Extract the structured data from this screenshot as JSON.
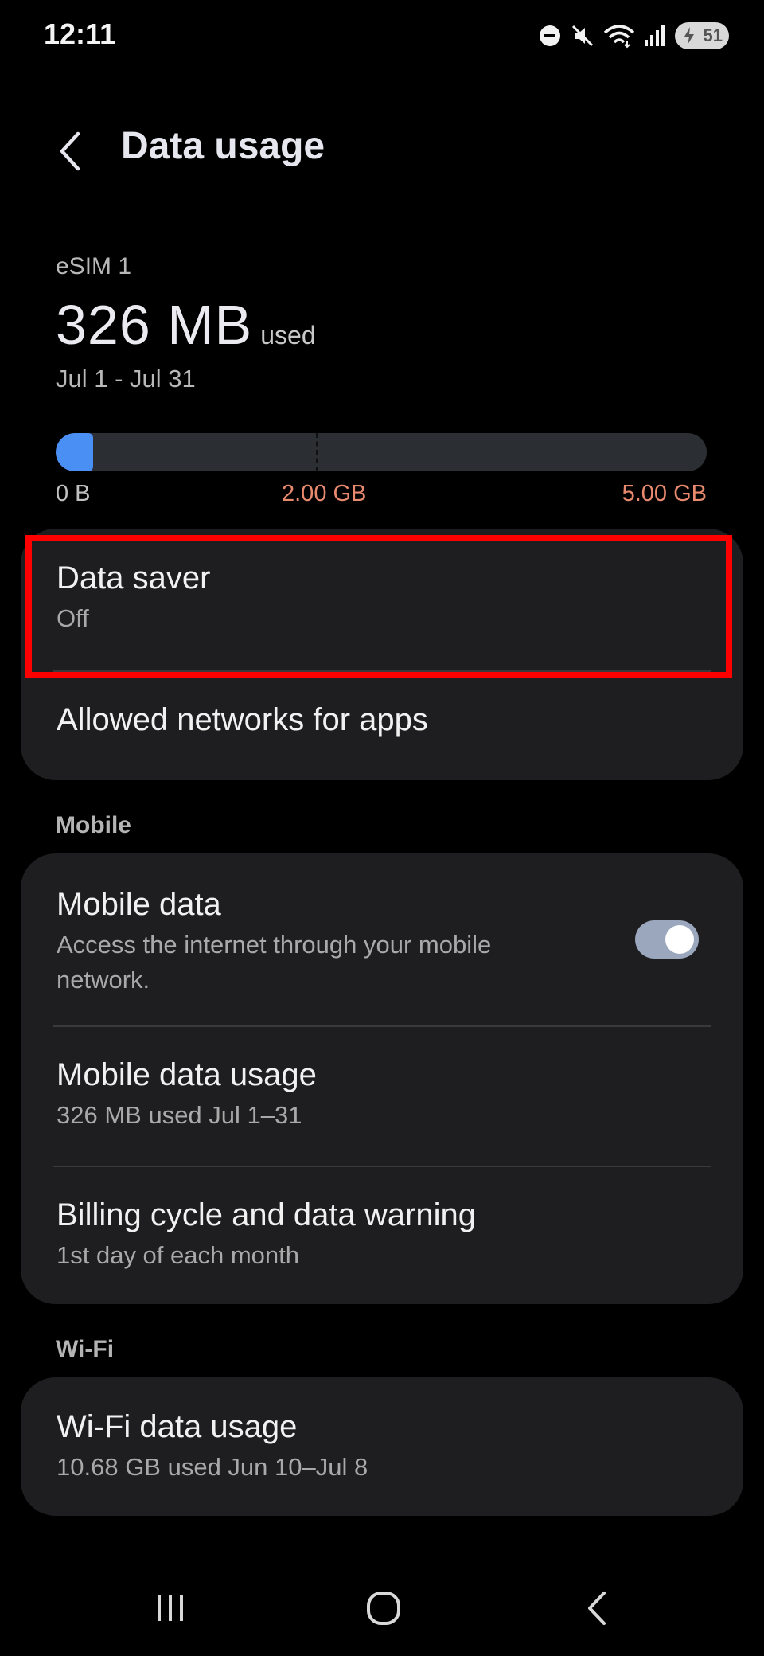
{
  "status_bar": {
    "time": "12:11",
    "battery_level": "51",
    "icons": [
      "do-not-disturb-icon",
      "mute-icon",
      "wifi-icon",
      "signal-icon",
      "battery-icon"
    ]
  },
  "header": {
    "title": "Data usage",
    "back_icon": "chevron-left-icon"
  },
  "usage": {
    "sim_label": "eSIM 1",
    "used_amount": "326 MB",
    "used_suffix": "used",
    "period": "Jul 1 - Jul 31",
    "fill_fraction": 0.058,
    "warning_fraction": 0.4,
    "bar_min_label": "0 B",
    "bar_warning_label": "2.00 GB",
    "bar_max_label": "5.00 GB",
    "colors": {
      "fill": "#4a8ff4",
      "track": "#2b2e33",
      "warning_text": "#e98a6f"
    }
  },
  "saver_card": {
    "data_saver": {
      "title": "Data saver",
      "status": "Off"
    },
    "allowed_networks": {
      "title": "Allowed networks for apps"
    }
  },
  "mobile_section": {
    "label": "Mobile",
    "mobile_data": {
      "title": "Mobile data",
      "description": "Access the internet through your mobile network.",
      "enabled": true
    },
    "mobile_data_usage": {
      "title": "Mobile data usage",
      "subtitle": "326 MB used Jul 1–31"
    },
    "billing_cycle": {
      "title": "Billing cycle and data warning",
      "subtitle": "1st day of each month"
    }
  },
  "wifi_section": {
    "label": "Wi-Fi",
    "wifi_data_usage": {
      "title": "Wi-Fi data usage",
      "subtitle": "10.68 GB used Jun 10–Jul 8"
    }
  },
  "highlight": {
    "color": "#ff0000"
  },
  "nav_bar": {
    "icons": [
      "recent-apps-icon",
      "home-icon",
      "back-icon"
    ]
  }
}
